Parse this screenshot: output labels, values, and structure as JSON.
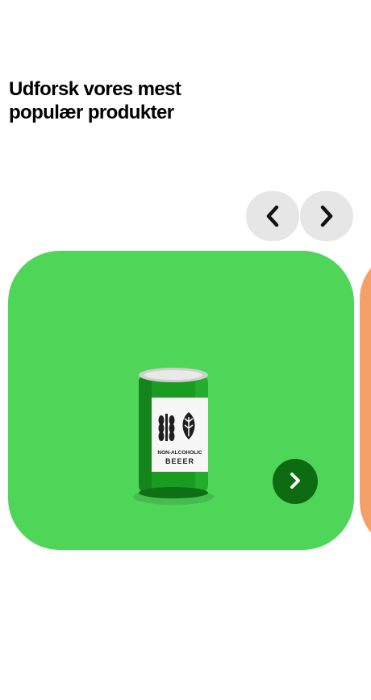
{
  "section": {
    "title": "Udforsk vores mest populær produkter"
  },
  "carousel": {
    "prev_icon": "chevron-left-icon",
    "next_icon": "chevron-right-icon",
    "nav_button_color": "#e6e6e6",
    "cards": [
      {
        "product_label_line1": "NON-ALCOHOLIC",
        "product_label_line2": "BEEER",
        "image": "green-beer-can",
        "background": "#4fd658",
        "arrow_icon": "chevron-right-icon",
        "arrow_color": "#0d6b12"
      },
      {
        "background": "#f5a068"
      }
    ]
  }
}
